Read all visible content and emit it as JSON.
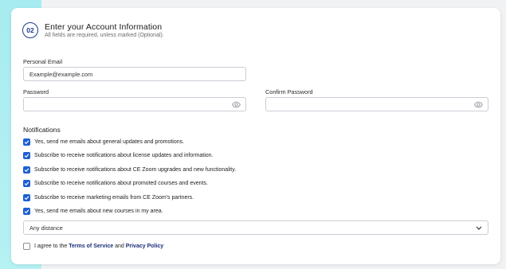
{
  "step": "02",
  "title": "Enter your Account Information",
  "subtitle": "All fields are required, unless marked (Optional).",
  "email": {
    "label": "Personal Email",
    "value": "Example@example.com"
  },
  "password": {
    "label": "Password",
    "value": ""
  },
  "confirm_password": {
    "label": "Confirm Password",
    "value": ""
  },
  "notifications": {
    "heading": "Notifications",
    "items": [
      {
        "label": "Yes, send me emails about general updates and promotions.",
        "checked": true
      },
      {
        "label": "Subscribe to receive notifications about license updates and information.",
        "checked": true
      },
      {
        "label": "Subscribe to receive notifications about CE Zoom upgrades and new functionality.",
        "checked": true
      },
      {
        "label": "Subscribe to receive notifications about promoted courses and events.",
        "checked": true
      },
      {
        "label": "Subscribe to receive marketing emails from CE Zoom's partners.",
        "checked": true
      },
      {
        "label": "Yes, send me emails about new courses in my area.",
        "checked": true
      }
    ]
  },
  "distance": {
    "selected": "Any distance"
  },
  "agreement": {
    "prefix": "I agree to the",
    "terms": "Terms of Service",
    "conjunction": "and",
    "privacy": "Privacy Policy",
    "checked": false
  },
  "colors": {
    "accent": "#1f5fd1",
    "brand_navy": "#1a3b8c",
    "side_band": "#a7ecf0"
  },
  "icons": {
    "password_toggle": "eye-icon",
    "dropdown": "chevron-down-icon",
    "checkbox": "check-icon"
  }
}
